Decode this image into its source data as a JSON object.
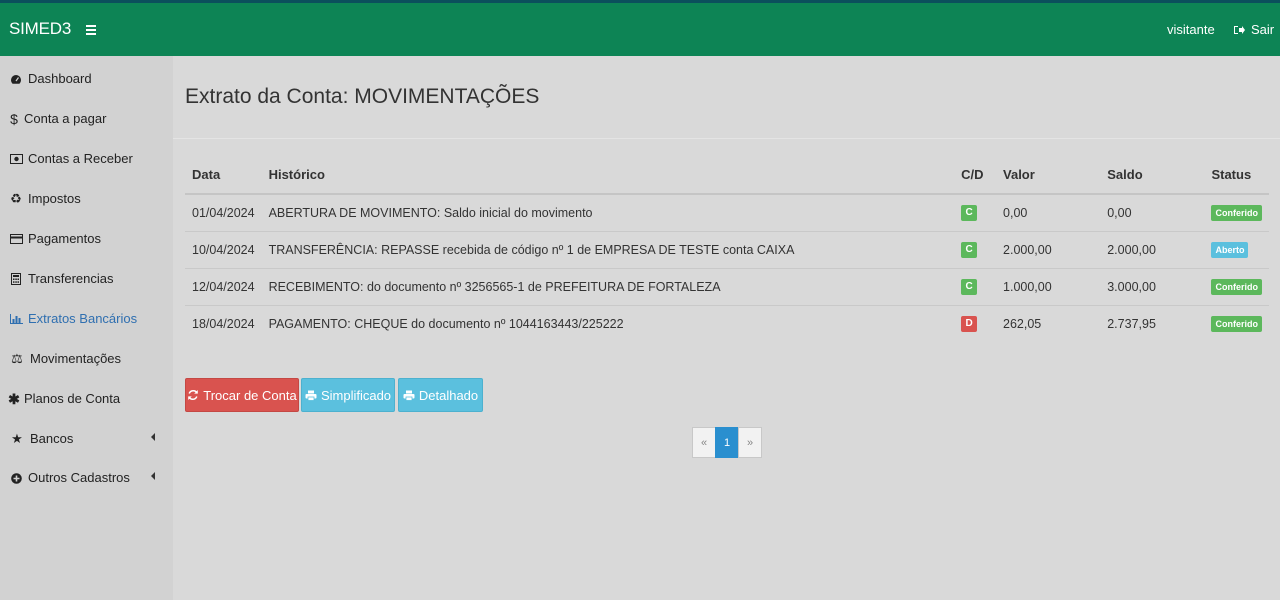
{
  "navbar": {
    "brand": "SIMED3",
    "user": "visitante",
    "logout": "Sair"
  },
  "sidebar": {
    "items": [
      {
        "label": "Dashboard",
        "icon": "tachometer-icon"
      },
      {
        "label": "Conta a pagar",
        "icon": "dollar-icon"
      },
      {
        "label": "Contas a Receber",
        "icon": "money-icon"
      },
      {
        "label": "Impostos",
        "icon": "recycle-icon"
      },
      {
        "label": "Pagamentos",
        "icon": "credit-card-icon"
      },
      {
        "label": "Transferencias",
        "icon": "calculator-icon"
      },
      {
        "label": "Extratos Bancários",
        "icon": "bar-chart-icon",
        "active": true
      },
      {
        "label": "Movimentações",
        "icon": "balance-scale-icon"
      },
      {
        "label": "Planos de Conta",
        "icon": "asterisk-icon"
      },
      {
        "label": "Bancos",
        "icon": "star-icon",
        "submenu": true
      },
      {
        "label": "Outros Cadastros",
        "icon": "plus-circle-icon",
        "submenu": true
      }
    ]
  },
  "page": {
    "title": "Extrato da Conta: MOVIMENTAÇÕES"
  },
  "table": {
    "headers": {
      "date": "Data",
      "history": "Histórico",
      "cd": "C/D",
      "value": "Valor",
      "balance": "Saldo",
      "status": "Status"
    },
    "rows": [
      {
        "date": "01/04/2024",
        "history": "ABERTURA DE MOVIMENTO: Saldo inicial do movimento",
        "cd": "C",
        "value": "0,00",
        "balance": "0,00",
        "status": "Conferido"
      },
      {
        "date": "10/04/2024",
        "history": "TRANSFERÊNCIA: REPASSE recebida de código nº 1 de EMPRESA DE TESTE conta CAIXA",
        "cd": "C",
        "value": "2.000,00",
        "balance": "2.000,00",
        "status": "Aberto"
      },
      {
        "date": "12/04/2024",
        "history": "RECEBIMENTO: do documento nº 3256565-1 de PREFEITURA DE FORTALEZA",
        "cd": "C",
        "value": "1.000,00",
        "balance": "3.000,00",
        "status": "Conferido"
      },
      {
        "date": "18/04/2024",
        "history": "PAGAMENTO: CHEQUE do documento nº 1044163443/225222",
        "cd": "D",
        "value": "262,05",
        "balance": "2.737,95",
        "status": "Conferido"
      }
    ]
  },
  "buttons": {
    "change_account": "Trocar de Conta",
    "simplified": "Simplificado",
    "detailed": "Detalhado"
  },
  "pagination": {
    "prev": "«",
    "current": "1",
    "next": "»"
  },
  "colors": {
    "navbar": "#0d8455",
    "sidebar": "#d2d2d2",
    "content": "#d9d9d9",
    "active_link": "#2f6fb0",
    "danger": "#d9534f",
    "info": "#5bc0de",
    "success": "#5cb85c"
  }
}
